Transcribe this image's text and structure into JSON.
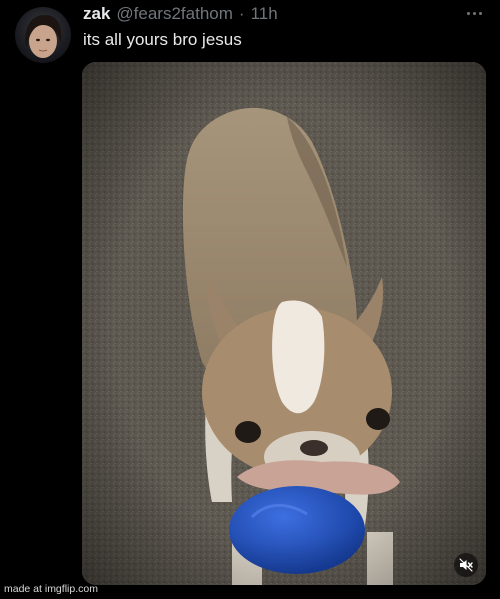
{
  "tweet": {
    "display_name": "zak",
    "handle": "@fears2fathom",
    "separator": "·",
    "time": "11h",
    "text": "its all yours bro jesus"
  },
  "icons": {
    "avatar": "avatar",
    "more": "more-options-icon",
    "mute": "muted-speaker-icon"
  },
  "media": {
    "kind": "video",
    "subject": "dog",
    "muted": true
  },
  "watermark": "made at imgflip.com"
}
